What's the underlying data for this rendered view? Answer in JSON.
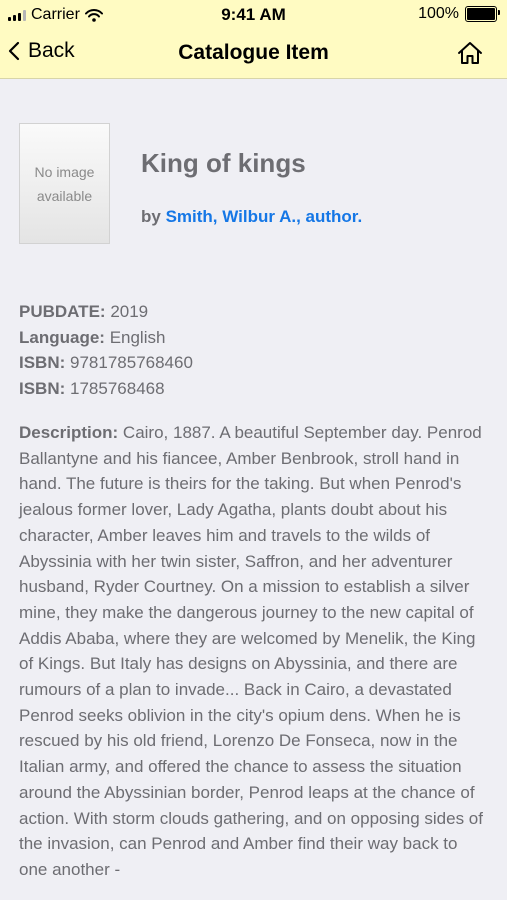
{
  "status_bar": {
    "carrier": "Carrier",
    "time": "9:41 AM",
    "battery": "100%"
  },
  "nav": {
    "back_label": "Back",
    "title": "Catalogue Item"
  },
  "cover": {
    "placeholder": "No image available"
  },
  "item": {
    "title": "King of kings",
    "by_prefix": "by",
    "author": "Smith, Wilbur A., author."
  },
  "details": {
    "pubdate_label": "PUBDATE:",
    "pubdate": "2019",
    "language_label": "Language:",
    "language": "English",
    "isbn_label": "ISBN:",
    "isbn13": "9781785768460",
    "isbn2_label": "ISBN:",
    "isbn10": "1785768468"
  },
  "description": {
    "label": "Description:",
    "text": "Cairo, 1887. A beautiful September day. Penrod Ballantyne and his fiancee, Amber Benbrook, stroll hand in hand. The future is theirs for the taking. But when Penrod's jealous former lover, Lady Agatha, plants doubt about his character, Amber leaves him and travels to the wilds of Abyssinia with her twin sister, Saffron, and her adventurer husband, Ryder Courtney. On a mission to establish a silver mine, they make the dangerous journey to the new capital of Addis Ababa, where they are welcomed by Menelik, the King of Kings. But Italy has designs on Abyssinia, and there are rumours of a plan to invade... Back in Cairo, a devastated Penrod seeks oblivion in the city's opium dens. When he is rescued by his old friend, Lorenzo De Fonseca, now in the Italian army, and offered the chance to assess the situation around the Abyssinian border, Penrod leaps at the chance of action. With storm clouds gathering, and on opposing sides of the invasion, can Penrod and Amber find their way back to one another -"
  },
  "icons": {
    "back": "chevron-left-icon",
    "home": "home-icon",
    "wifi": "wifi-icon",
    "battery": "battery-icon",
    "signal": "signal-icon"
  }
}
